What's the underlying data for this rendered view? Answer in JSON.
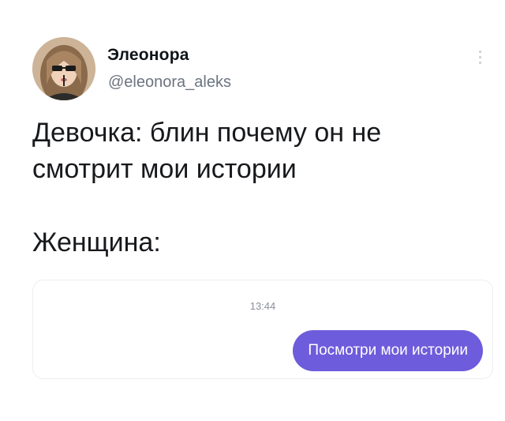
{
  "author": {
    "display_name": "Элеонора",
    "handle": "@eleonora_aleks"
  },
  "tweet": {
    "line1": "Девочка: блин почему он не",
    "line2": "смотрит мои истории",
    "line3": "Женщина:"
  },
  "chat": {
    "time": "13:44",
    "message": "Посмотри мои истории",
    "bubble_color": "#6d5cdb"
  },
  "icons": {
    "more": "more-vertical-icon"
  }
}
